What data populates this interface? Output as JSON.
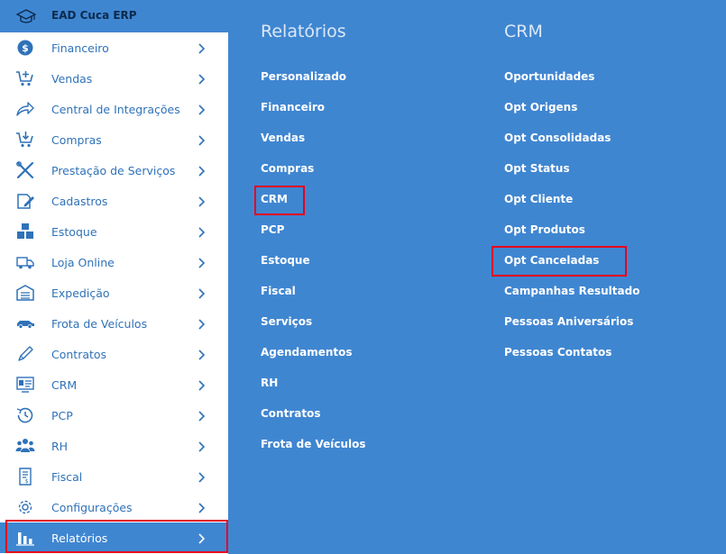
{
  "header": {
    "title": "EAD Cuca ERP",
    "logo_icon": "graduation-cap-icon"
  },
  "sidebar": {
    "items": [
      {
        "label": "Financeiro",
        "icon": "dollar-circle-icon"
      },
      {
        "label": "Vendas",
        "icon": "cart-plus-icon"
      },
      {
        "label": "Central de Integrações",
        "icon": "share-arrow-icon"
      },
      {
        "label": "Compras",
        "icon": "cart-down-icon"
      },
      {
        "label": "Prestação de Serviços",
        "icon": "tools-icon"
      },
      {
        "label": "Cadastros",
        "icon": "edit-icon"
      },
      {
        "label": "Estoque",
        "icon": "boxes-icon"
      },
      {
        "label": "Loja Online",
        "icon": "truck-icon"
      },
      {
        "label": "Expedição",
        "icon": "warehouse-icon"
      },
      {
        "label": "Frota de Veículos",
        "icon": "car-icon"
      },
      {
        "label": "Contratos",
        "icon": "pen-icon"
      },
      {
        "label": "CRM",
        "icon": "id-card-icon"
      },
      {
        "label": "PCP",
        "icon": "clock-history-icon"
      },
      {
        "label": "RH",
        "icon": "users-icon"
      },
      {
        "label": "Fiscal",
        "icon": "receipt-icon"
      },
      {
        "label": "Configurações",
        "icon": "gear-icon"
      },
      {
        "label": "Relatórios",
        "icon": "bar-chart-icon"
      }
    ]
  },
  "reports": {
    "title": "Relatórios",
    "links": [
      "Personalizado",
      "Financeiro",
      "Vendas",
      "Compras",
      "CRM",
      "PCP",
      "Estoque",
      "Fiscal",
      "Serviços",
      "Agendamentos",
      "RH",
      "Contratos",
      "Frota de Veículos"
    ]
  },
  "crm": {
    "title": "CRM",
    "links": [
      "Oportunidades",
      "Opt Origens",
      "Opt Consolidadas",
      "Opt Status",
      "Opt Cliente",
      "Opt Produtos",
      "Opt Canceladas",
      "Campanhas Resultado",
      "Pessoas Aniversários",
      "Pessoas Contatos"
    ]
  },
  "colors": {
    "accent": "#3f86d1",
    "sidebar_text": "#2f72b8",
    "highlight": "#e8001c"
  }
}
